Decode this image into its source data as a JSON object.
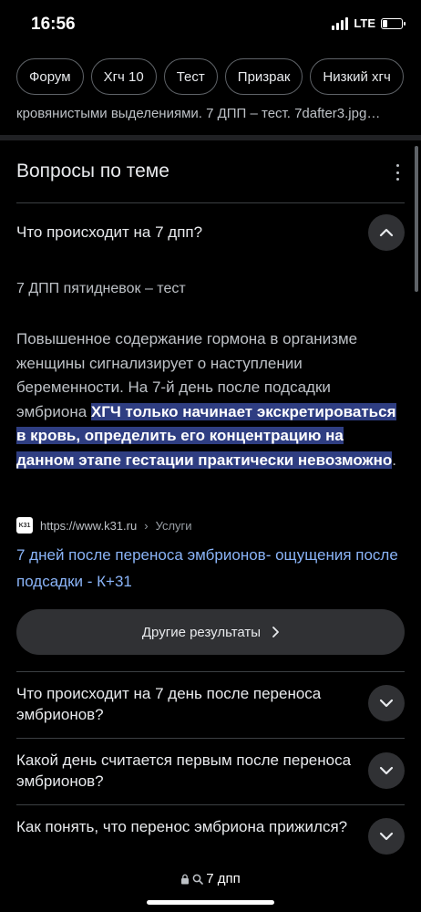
{
  "status": {
    "time": "16:56",
    "network": "LTE"
  },
  "chips": [
    {
      "label": "Форум"
    },
    {
      "label": "Хгч 10"
    },
    {
      "label": "Тест"
    },
    {
      "label": "Призрак"
    },
    {
      "label": "Низкий хгч"
    }
  ],
  "snippet_tail": "кровянистыми выделениями. 7 ДПП – тест. 7dafter3.jpg…",
  "section": {
    "title": "Вопросы по теме"
  },
  "expanded": {
    "question": "Что происходит на 7 дпп?",
    "answer_heading": "7 ДПП пятидневок – тест",
    "answer_text_before": "Повышенное содержание гормона в организме женщины сигнализирует о наступлении беременности. На 7-й день после подсадки эмбриона ",
    "answer_text_highlight": "ХГЧ только начинает экскретироваться в кровь, определить его концентрацию на данном этапе гестации практически невозможно",
    "answer_text_after": ".",
    "source_favicon": "K31",
    "source_url": "https://www.k31.ru",
    "source_sep": "›",
    "source_path": "Услуги",
    "result_title": "7 дней после переноса эмбрионов- ощущения после подсадки - К+31"
  },
  "more_results_label": "Другие результаты",
  "questions": [
    {
      "text": "Что происходит на 7 день после переноса эмбрионов?"
    },
    {
      "text": "Какой день считается первым после переноса эмбрионов?"
    },
    {
      "text": "Как понять, что перенос эмбриона прижился?"
    }
  ],
  "address_bar": {
    "query": "7 дпп"
  },
  "colors": {
    "background": "#000000",
    "link": "#8ab4f8",
    "highlight": "#2f3e82",
    "button": "#303134"
  }
}
